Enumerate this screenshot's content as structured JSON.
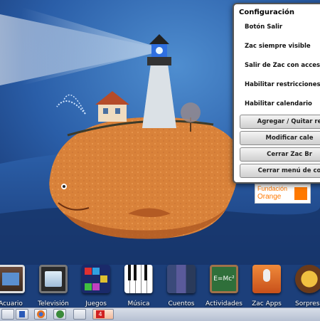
{
  "config_menu": {
    "title": "Configuración",
    "options": [
      "Botón Salir",
      "Zac siempre visible",
      "Salir de Zac con acceso dire",
      "Habilitar restricciones web",
      "Habilitar calendario"
    ],
    "buttons": [
      "Agregar / Quitar re",
      "Modificar cale",
      "Cerrar Zac Br",
      "Cerrar menú de co"
    ]
  },
  "logo": {
    "line1": "Fundación",
    "line2": "Orange",
    "brand_color": "#ff7900"
  },
  "dock": {
    "items": [
      {
        "label": "Acuario",
        "icon": "aquarium-icon"
      },
      {
        "label": "Televisión",
        "icon": "television-icon"
      },
      {
        "label": "Juegos",
        "icon": "tetris-blocks-icon"
      },
      {
        "label": "Música",
        "icon": "piano-keys-icon"
      },
      {
        "label": "Cuentos",
        "icon": "books-icon"
      },
      {
        "label": "Actividades",
        "icon": "chalkboard-icon"
      },
      {
        "label": "Zac Apps",
        "icon": "microphone-icon"
      },
      {
        "label": "Sorpresa",
        "icon": "surprise-icon"
      }
    ],
    "badge": "4"
  },
  "colors": {
    "sky": "#1c3f7a",
    "whale": "#d9823a",
    "taskbar": "#c7cfdc"
  }
}
